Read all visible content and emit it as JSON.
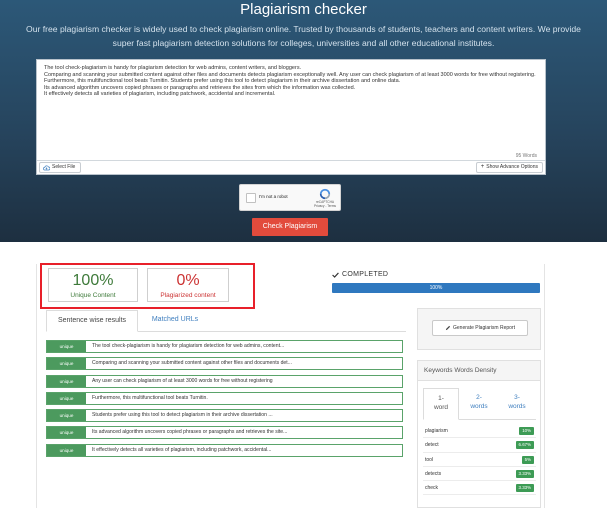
{
  "hero": {
    "title": "Plagiarism checker",
    "subtitle": "Our free plagiarism checker is widely used to check plagiarism online. Trusted by thousands of students, teachers and content writers. We provide super fast plagiarism detection solutions for colleges, universities and all other educational institutes."
  },
  "editor": {
    "lines": [
      "The tool check-plagiarism is handy for plagiarism detection for web admins, content writers, and bloggers.",
      "Comparing and scanning your submitted content against other files and documents detects plagiarism exceptionally well. Any user can check plagiarism of at least 3000 words for free without registering.",
      "Furthermore, this multifunctional tool beats Turnitin. Students prefer using this tool to detect plagiarism in their archive dissertation and online data.",
      "Its advanced algorithm uncovers copied phrases or paragraphs and retrieves the sites from which the information was collected.",
      "It effectively detects all varieties of plagiarism, including patchwork, accidental and incremental."
    ],
    "word_count": "95 Words",
    "select_file": "Select File",
    "advance_options": "Show Advance Options"
  },
  "captcha": {
    "label": "I'm not a robot",
    "brand": "reCAPTCHA",
    "links": "Privacy - Terms"
  },
  "check_button": "Check Plagiarism",
  "scores": {
    "unique_value": "100%",
    "unique_label": "Unique Content",
    "plag_value": "0%",
    "plag_label": "Plagiarized content"
  },
  "status": {
    "text": "COMPLETED",
    "progress_label": "100%",
    "progress": 1.0
  },
  "tabs": {
    "sentence": "Sentence wise results",
    "urls": "Matched URLs"
  },
  "sentences": [
    {
      "badge": "unique",
      "text": "The tool check-plagiarism is handy for plagiarism detection for web admins, content..."
    },
    {
      "badge": "unique",
      "text": "Comparing and scanning your submitted content against other files and documents det..."
    },
    {
      "badge": "unique",
      "text": "Any user can check plagiarism of at least 3000 words for free without registering"
    },
    {
      "badge": "unique",
      "text": "Furthermore, this multifunctional tool beats Turnitin."
    },
    {
      "badge": "unique",
      "text": "Students prefer using this tool to detect plagiarism in their archive dissertation ..."
    },
    {
      "badge": "unique",
      "text": "Its advanced algorithm uncovers copied phrases or paragraphs and retrieves the site..."
    },
    {
      "badge": "unique",
      "text": "It effectively detects all varieties of plagiarism, including patchwork, accidental..."
    }
  ],
  "report_button": "Generate Plagiarism Report",
  "keywords": {
    "heading": "Keywords Words Density",
    "tab1": [
      "1-",
      "word"
    ],
    "tab2": [
      "2-",
      "words"
    ],
    "tab3": [
      "3-",
      "words"
    ],
    "items": [
      {
        "word": "plagiarism",
        "pct": "10%"
      },
      {
        "word": "detect",
        "pct": "6.67%"
      },
      {
        "word": "tool",
        "pct": "5%"
      },
      {
        "word": "detects",
        "pct": "3.33%"
      },
      {
        "word": "check",
        "pct": "3.33%"
      }
    ]
  },
  "colors": {
    "hero_bg": "#26445d",
    "check_button": "#e24b3c",
    "unique_green": "#3e7a3a",
    "plag_red": "#cc3333",
    "progress_blue": "#2f78bf",
    "badge_green": "#4c9a5e",
    "highlight_red": "#e8202a"
  }
}
